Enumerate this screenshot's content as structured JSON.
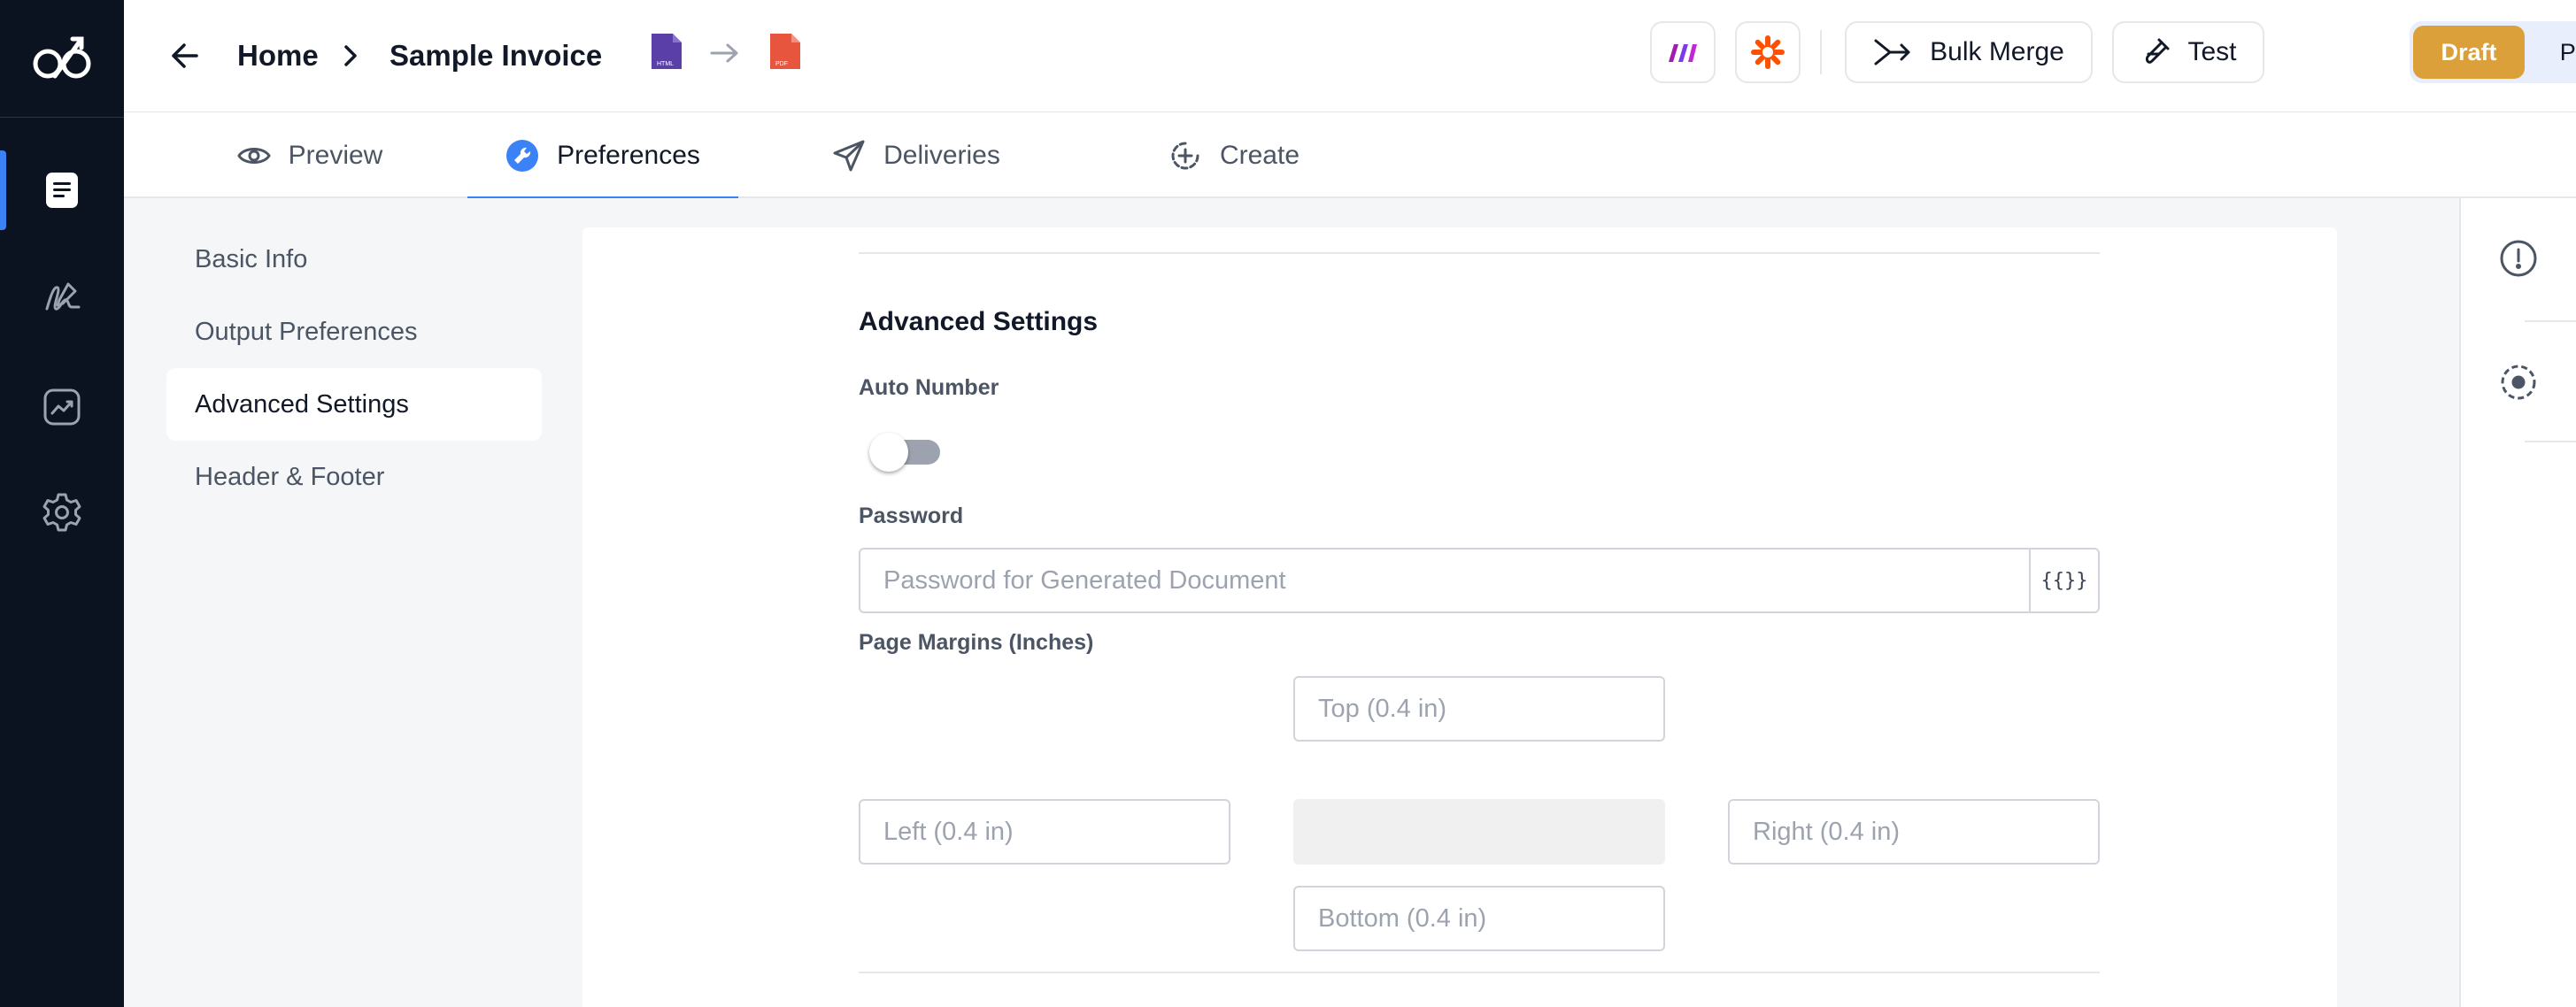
{
  "app": {
    "logo_icon": "app-logo-icon"
  },
  "rail": {
    "items": [
      {
        "name": "documents",
        "icon": "document-icon",
        "active": true
      },
      {
        "name": "signatures",
        "icon": "signature-icon",
        "active": false
      },
      {
        "name": "analytics",
        "icon": "analytics-icon",
        "active": false
      },
      {
        "name": "settings",
        "icon": "gear-icon",
        "active": false
      }
    ]
  },
  "header": {
    "breadcrumb": {
      "home": "Home",
      "current": "Sample Invoice"
    },
    "source_format": "HTML",
    "target_format": "PDF",
    "integrations": [
      "make-icon",
      "zapier-icon"
    ],
    "bulk_merge_label": "Bulk Merge",
    "test_label": "Test",
    "draft_label": "Draft",
    "publish_label": "Publish",
    "colors": {
      "draft": "#dba03a",
      "accent": "#3b82f6"
    }
  },
  "tabs": [
    {
      "label": "Preview",
      "icon": "eye-icon"
    },
    {
      "label": "Preferences",
      "icon": "wrench-icon",
      "active": true
    },
    {
      "label": "Deliveries",
      "icon": "paper-plane-icon"
    },
    {
      "label": "Create",
      "icon": "plus-circle-icon"
    }
  ],
  "subnav": {
    "items": [
      "Basic Info",
      "Output Preferences",
      "Advanced Settings",
      "Header & Footer"
    ],
    "active_index": 2
  },
  "advanced": {
    "title": "Advanced Settings",
    "auto_number_label": "Auto Number",
    "auto_number_enabled": false,
    "password_label": "Password",
    "password_placeholder": "Password for Generated Document",
    "password_value": "",
    "password_addon": "{{}}",
    "margins_label": "Page Margins (Inches)",
    "margins": {
      "top_placeholder": "Top (0.4 in)",
      "left_placeholder": "Left (0.4 in)",
      "right_placeholder": "Right (0.4 in)",
      "bottom_placeholder": "Bottom (0.4 in)"
    }
  },
  "right_rail": {
    "items": [
      "info-icon",
      "target-icon"
    ]
  }
}
